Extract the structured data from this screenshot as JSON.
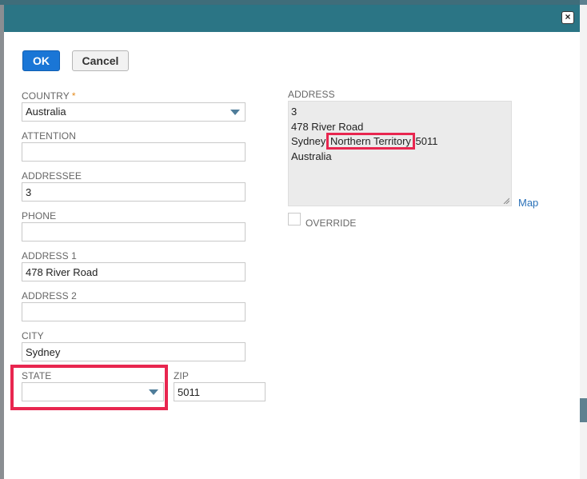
{
  "buttons": {
    "ok": "OK",
    "cancel": "Cancel",
    "close": "×"
  },
  "form": {
    "country": {
      "label": "COUNTRY",
      "required_mark": "*",
      "value": "Australia"
    },
    "attention": {
      "label": "ATTENTION",
      "value": ""
    },
    "addressee": {
      "label": "ADDRESSEE",
      "value": "3"
    },
    "phone": {
      "label": "PHONE",
      "value": ""
    },
    "address1": {
      "label": "ADDRESS 1",
      "value": "478 River Road"
    },
    "address2": {
      "label": "ADDRESS 2",
      "value": ""
    },
    "city": {
      "label": "CITY",
      "value": "Sydney"
    },
    "state": {
      "label": "STATE",
      "value": ""
    },
    "zip": {
      "label": "ZIP",
      "value": "5011"
    }
  },
  "address_preview": {
    "label": "ADDRESS",
    "line1": "3",
    "line2": "478 River Road",
    "line3_city": "Sydney",
    "line3_state": "Northern Territory",
    "line3_zip": "5011",
    "line4": "Australia",
    "map_link": "Map",
    "override_label": "OVERRIDE"
  },
  "colors": {
    "header": "#2b7585",
    "ok_button": "#1a76d6",
    "highlight": "#e8264f",
    "required": "#e48b1e",
    "link": "#2a71b8"
  },
  "icons": {
    "close": "close-icon",
    "dropdown": "chevron-down-icon",
    "resize": "resize-grip-icon"
  }
}
